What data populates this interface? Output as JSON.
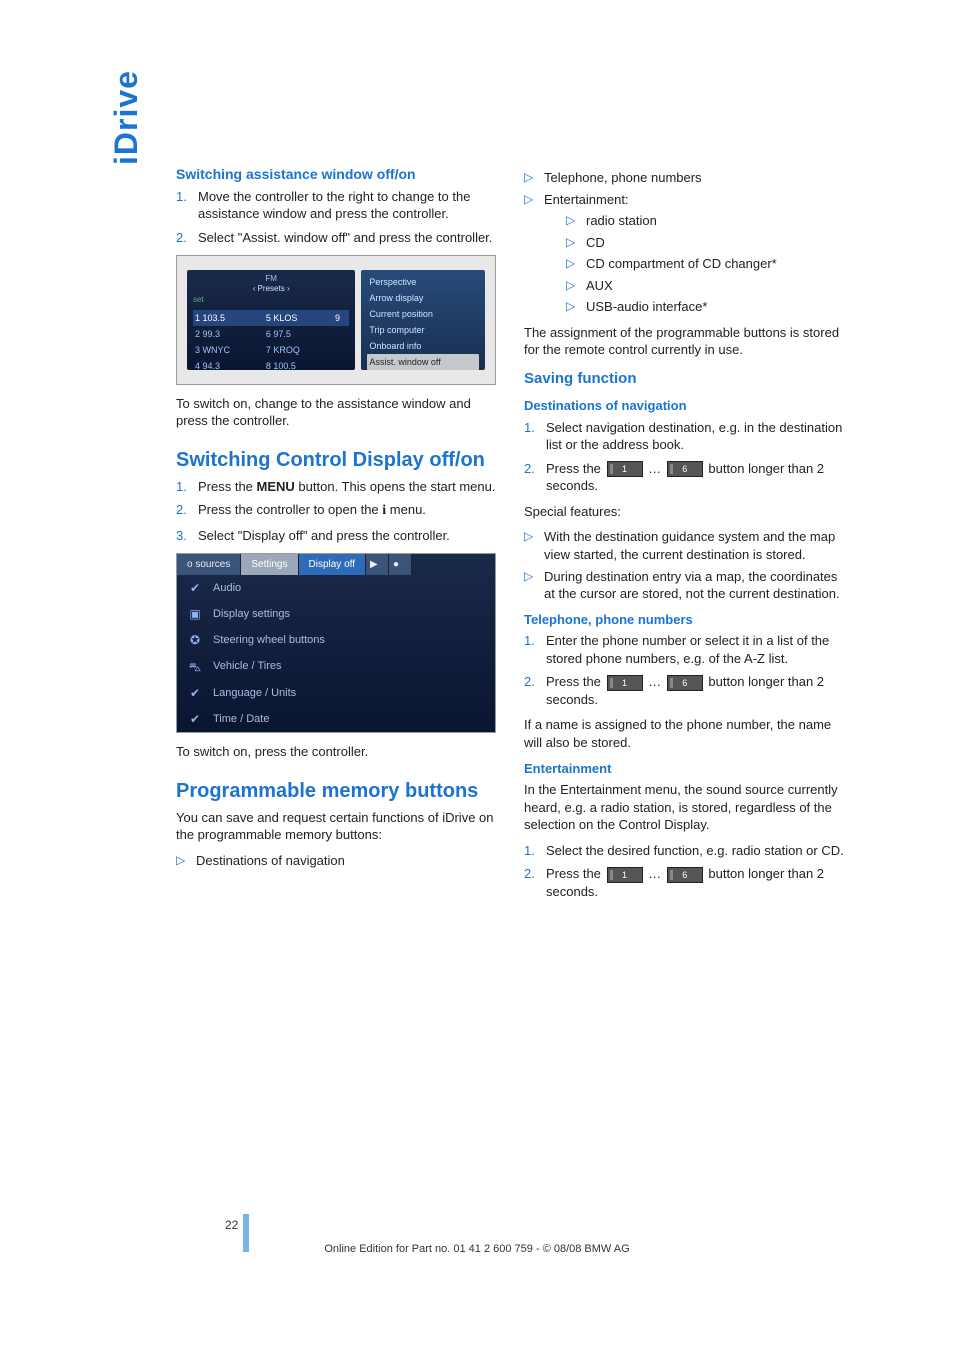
{
  "sidebar_tab": "iDrive",
  "col1": {
    "h1": "Switching assistance window off/on",
    "list1": [
      "Move the controller to the right to change to the assistance window and press the controller.",
      "Select \"Assist. window off\" and press the controller."
    ],
    "shot1": {
      "topbar_text": "FM",
      "presets_label": "Presets",
      "rows": [
        [
          "1 103.5",
          "5 KLOS",
          "9"
        ],
        [
          "2 99.3",
          "6 97.5",
          ""
        ],
        [
          "3 WNYC",
          "7 KROQ",
          ""
        ],
        [
          "4 94.3",
          "8 100.5",
          ""
        ]
      ],
      "right_items": [
        "Perspective",
        "Arrow display",
        "Current position",
        "Trip computer",
        "Onboard info",
        "Assist. window off"
      ]
    },
    "after_shot1": "To switch on, change to the assistance window and press the controller.",
    "h2": "Switching Control Display off/on",
    "list2": [
      {
        "pre": "Press the ",
        "bold": "MENU",
        "post": " button. This opens the start menu."
      },
      {
        "pre": "Press the controller to open the ",
        "icon": "i",
        "post": " menu."
      },
      {
        "pre": "Select \"Display off\" and press the controller.",
        "bold": "",
        "post": ""
      }
    ],
    "shot2": {
      "tabs": [
        "o sources",
        "Settings",
        "Display off"
      ],
      "rows": [
        {
          "icon": "✔",
          "label": "Audio"
        },
        {
          "icon": "▣",
          "label": "Display settings"
        },
        {
          "icon": "✪",
          "label": "Steering wheel buttons"
        },
        {
          "icon": "⛍",
          "label": "Vehicle / Tires"
        },
        {
          "icon": "✔",
          "label": "Language / Units"
        },
        {
          "icon": "✔",
          "label": "Time / Date"
        }
      ]
    },
    "after_shot2": "To switch on, press the controller.",
    "h3": "Programmable memory buttons",
    "p3": "You can save and request certain functions of iDrive on the programmable memory buttons:",
    "tri1": [
      "Destinations of navigation"
    ]
  },
  "col2": {
    "tri_top": [
      "Telephone, phone numbers",
      "Entertainment:"
    ],
    "tri_ent_sub": [
      "radio station",
      "CD",
      "CD compartment of CD changer*",
      "AUX",
      "USB-audio interface*"
    ],
    "p_assign": "The assignment of the programmable buttons is stored for the remote control currently in use.",
    "h_saving": "Saving function",
    "h_dest": "Destinations of navigation",
    "dest_steps": [
      "Select navigation destination, e.g. in the destination list or the address book.",
      {
        "pre": "Press the ",
        "k1": "1",
        "mid": " … ",
        "k2": "6",
        "post": " button longer than 2 seconds."
      }
    ],
    "special_label": "Special features:",
    "special_items": [
      "With the destination guidance system and the map view started, the current destination is stored.",
      "During destination entry via a map, the coordinates at the cursor are stored, not the current destination."
    ],
    "h_tel": "Telephone, phone numbers",
    "tel_steps": [
      "Enter the phone number or select it in a list of the stored phone numbers, e.g. of the A-Z list.",
      {
        "pre": "Press the ",
        "k1": "1",
        "mid": " … ",
        "k2": "6",
        "post": " button longer than 2 seconds."
      }
    ],
    "tel_note": "If a name is assigned to the phone number, the name will also be stored.",
    "h_ent": "Entertainment",
    "ent_p": "In the Entertainment menu, the sound source currently heard, e.g. a radio station, is stored, regardless of the selection on the Control Display.",
    "ent_steps": [
      "Select the desired function, e.g. radio station or CD.",
      {
        "pre": "Press the ",
        "k1": "1",
        "mid": " … ",
        "k2": "6",
        "post": " button longer than 2 seconds."
      }
    ]
  },
  "page_number": "22",
  "footer": "Online Edition for Part no. 01 41 2 600 759 - © 08/08 BMW AG"
}
